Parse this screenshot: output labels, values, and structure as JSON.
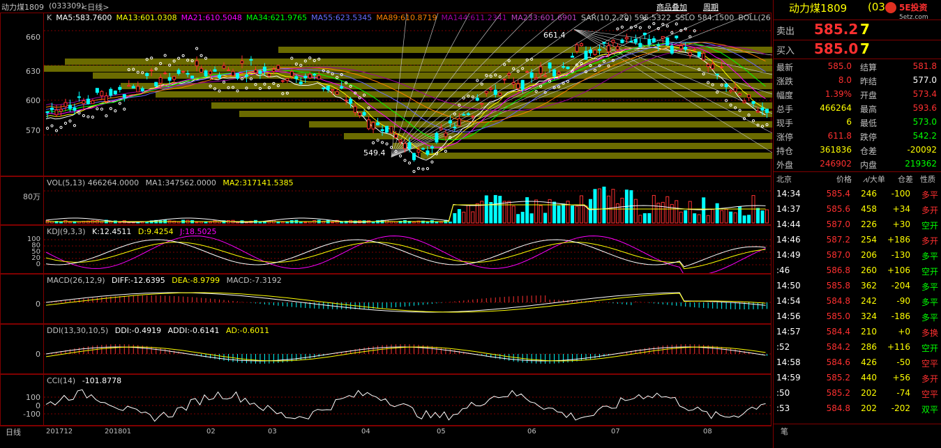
{
  "title": {
    "symbol_name": "动力煤1809",
    "code": "(033309)",
    "period": "<日线>"
  },
  "main_indicators": [
    {
      "label": "K",
      "color": "#c0c0c0"
    },
    {
      "label": "MA5:583.7600",
      "color": "#ffffff"
    },
    {
      "label": "MA13:601.0308",
      "color": "#ffff00"
    },
    {
      "label": "MA21:610.5048",
      "color": "#ff00ff"
    },
    {
      "label": "MA34:621.9765",
      "color": "#00ff00"
    },
    {
      "label": "MA55:623.5345",
      "color": "#6a6aff"
    },
    {
      "label": "MA89:610.8719",
      "color": "#ff8000"
    },
    {
      "label": "MA144:611.2341",
      "color": "#a000a0"
    },
    {
      "label": "MA233:601.6901",
      "color": "#c040c0"
    },
    {
      "label": "SAR(10,2,20) 595.5322",
      "color": "#c0c0c0"
    },
    {
      "label": "SSLO 584.1500",
      "color": "#c0c0c0"
    },
    {
      "label": "BOLL(26",
      "color": "#c0c0c0"
    }
  ],
  "price_axis": [
    "660",
    "630",
    "600",
    "570"
  ],
  "price_marks": {
    "high": "661.4",
    "low": "549.4"
  },
  "vol": {
    "label": "VOL(5,13) 466264.0000",
    "ma1": "MA1:347562.0000",
    "ma2": "MA2:317141.5385",
    "tick": "80万"
  },
  "kdj": {
    "label": "KDJ(9,3,3)",
    "k": "K:12.4511",
    "d": "D:9.4254",
    "j": "J:18.5025",
    "ticks": [
      "100",
      "80",
      "50",
      "20",
      "0"
    ]
  },
  "macd": {
    "label": "MACD(26,12,9)",
    "diff": "DIFF:-12.6395",
    "dea": "DEA:-8.9799",
    "macd": "MACD:-7.3192",
    "tick": "0"
  },
  "ddi": {
    "label": "DDI(13,30,10,5)",
    "ddi": "DDI:-0.4919",
    "addi": "ADDI:-0.6141",
    "ad": "AD:-0.6011",
    "tick": "0"
  },
  "cci": {
    "label": "CCI(14)",
    "value": "-101.8778",
    "ticks": [
      "100",
      "0",
      "-100"
    ]
  },
  "x_axis": {
    "period": "日线",
    "labels": [
      "201712",
      "201801",
      "02",
      "03",
      "04",
      "05",
      "06",
      "07",
      "08"
    ]
  },
  "topbar": {
    "overlay": "商品叠加",
    "cycle": "周期"
  },
  "quote": {
    "name": "动力煤1809",
    "code": "(033309)",
    "brand": "5E投资",
    "brand_sub": "5etz.com",
    "sell_label": "卖出",
    "sell_price": "585.2",
    "sell_vol": "7",
    "buy_label": "买入",
    "buy_price": "585.0",
    "buy_vol": "7",
    "stats": [
      {
        "l1": "最新",
        "v1": "585.0",
        "c1": "#ff3030",
        "l2": "结算",
        "v2": "581.8",
        "c2": "#ff3030"
      },
      {
        "l1": "涨跌",
        "v1": "8.0",
        "c1": "#ff3030",
        "l2": "昨结",
        "v2": "577.0",
        "c2": "#ffffff"
      },
      {
        "l1": "幅度",
        "v1": "1.39%",
        "c1": "#ff3030",
        "l2": "开盘",
        "v2": "573.4",
        "c2": "#ff3030"
      },
      {
        "l1": "总手",
        "v1": "466264",
        "c1": "#ffff00",
        "l2": "最高",
        "v2": "593.6",
        "c2": "#ff3030"
      },
      {
        "l1": "现手",
        "v1": "6",
        "c1": "#ffff00",
        "l2": "最低",
        "v2": "573.0",
        "c2": "#00ff00"
      },
      {
        "l1": "涨停",
        "v1": "611.8",
        "c1": "#ff3030",
        "l2": "跌停",
        "v2": "542.2",
        "c2": "#00ff00"
      },
      {
        "l1": "持仓",
        "v1": "361836",
        "c1": "#ffff00",
        "l2": "仓差",
        "v2": "-20092",
        "c2": "#ffff00"
      },
      {
        "l1": "外盘",
        "v1": "246902",
        "c1": "#ff3030",
        "l2": "内盘",
        "v2": "219362",
        "c2": "#00ff00"
      }
    ],
    "tick_header": {
      "time": "北京",
      "price": "价格",
      "vol": "⩘/大单",
      "oi": "仓差",
      "nature": "性质"
    },
    "ticks": [
      {
        "t": "14:34",
        "p": "585.4",
        "v": "246",
        "o": "-100",
        "n": "多平",
        "nc": "#ff3030"
      },
      {
        "t": "14:37",
        "p": "585.6",
        "v": "458",
        "o": "+34",
        "n": "多开",
        "nc": "#ff3030"
      },
      {
        "t": "14:44",
        "p": "587.0",
        "v": "226",
        "o": "+30",
        "n": "空开",
        "nc": "#00ff00"
      },
      {
        "t": "14:46",
        "p": "587.2",
        "v": "254",
        "o": "+186",
        "n": "多开",
        "nc": "#ff3030"
      },
      {
        "t": "14:49",
        "p": "587.0",
        "v": "206",
        "o": "-130",
        "n": "多平",
        "nc": "#00ff00"
      },
      {
        "t": ":46",
        "p": "586.8",
        "v": "260",
        "o": "+106",
        "n": "空开",
        "nc": "#00ff00"
      },
      {
        "t": "14:50",
        "p": "585.8",
        "v": "362",
        "o": "-204",
        "n": "多平",
        "nc": "#00ff00"
      },
      {
        "t": "14:54",
        "p": "584.8",
        "v": "242",
        "o": "-90",
        "n": "多平",
        "nc": "#00ff00"
      },
      {
        "t": "14:56",
        "p": "585.0",
        "v": "324",
        "o": "-186",
        "n": "多平",
        "nc": "#00ff00"
      },
      {
        "t": "14:57",
        "p": "584.4",
        "v": "210",
        "o": "+0",
        "n": "多换",
        "nc": "#ff3030"
      },
      {
        "t": ":52",
        "p": "584.2",
        "v": "286",
        "o": "+116",
        "n": "空开",
        "nc": "#00ff00"
      },
      {
        "t": "14:58",
        "p": "584.6",
        "v": "426",
        "o": "-50",
        "n": "空平",
        "nc": "#ff3030"
      },
      {
        "t": "14:59",
        "p": "585.2",
        "v": "440",
        "o": "+56",
        "n": "多开",
        "nc": "#ff3030"
      },
      {
        "t": ":50",
        "p": "585.2",
        "v": "202",
        "o": "-74",
        "n": "空平",
        "nc": "#ff3030"
      },
      {
        "t": ":53",
        "p": "584.8",
        "v": "202",
        "o": "-202",
        "n": "双平",
        "nc": "#00ff00"
      }
    ],
    "footer_tab": "笔"
  }
}
